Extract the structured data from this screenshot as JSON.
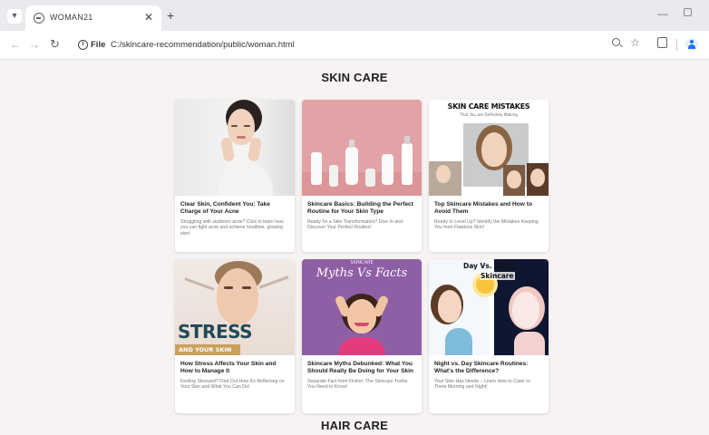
{
  "browser": {
    "tab_title": "WOMAN21",
    "url_scheme": "File",
    "url": "C:/skincare-recommendation/public/woman.html"
  },
  "page": {
    "section1_title": "SKIN CARE",
    "section2_title": "HAIR CARE",
    "cards": [
      {
        "title": "Clear Skin, Confident You: Take Charge of Your Acne",
        "desc": "Struggling with stubborn acne? Click to learn how you can fight acne and achieve healthier, glowing skin!",
        "image_text": []
      },
      {
        "title": "Skincare Basics: Building the Perfect Routine for Your Skin Type",
        "desc": "Ready for a Skin Transformation? Dive In and Discover Your Perfect Routine!",
        "image_text": []
      },
      {
        "title": "Top Skincare Mistakes and How to Avoid Them",
        "desc": "Ready to Level Up? Identify the Mistakes Keeping You from Flawless Skin!",
        "image_text": [
          "SKIN CARE MISTAKES",
          "That You are Definitely Making"
        ]
      },
      {
        "title": "How Stress Affects Your Skin and How to Manage It",
        "desc": "Feeling Stressed? Find Out How It's Reflecting on Your Skin and What You Can Do!",
        "image_text": [
          "STRESS",
          "AND YOUR SKIN"
        ]
      },
      {
        "title": "Skincare Myths Debunked: What You Should Really Be Doing for Your Skin",
        "desc": "Separate Fact from Fiction: The Skincare Truths You Need to Know!",
        "image_text": [
          "SKINCARE",
          "Myths Vs Facts"
        ]
      },
      {
        "title": "Night vs. Day Skincare Routines: What's the Difference?",
        "desc": "Your Skin Has Needs – Learn How to Cater to Them Morning and Night!",
        "image_text": [
          "Day Vs. Night",
          "Skincare"
        ]
      }
    ]
  }
}
